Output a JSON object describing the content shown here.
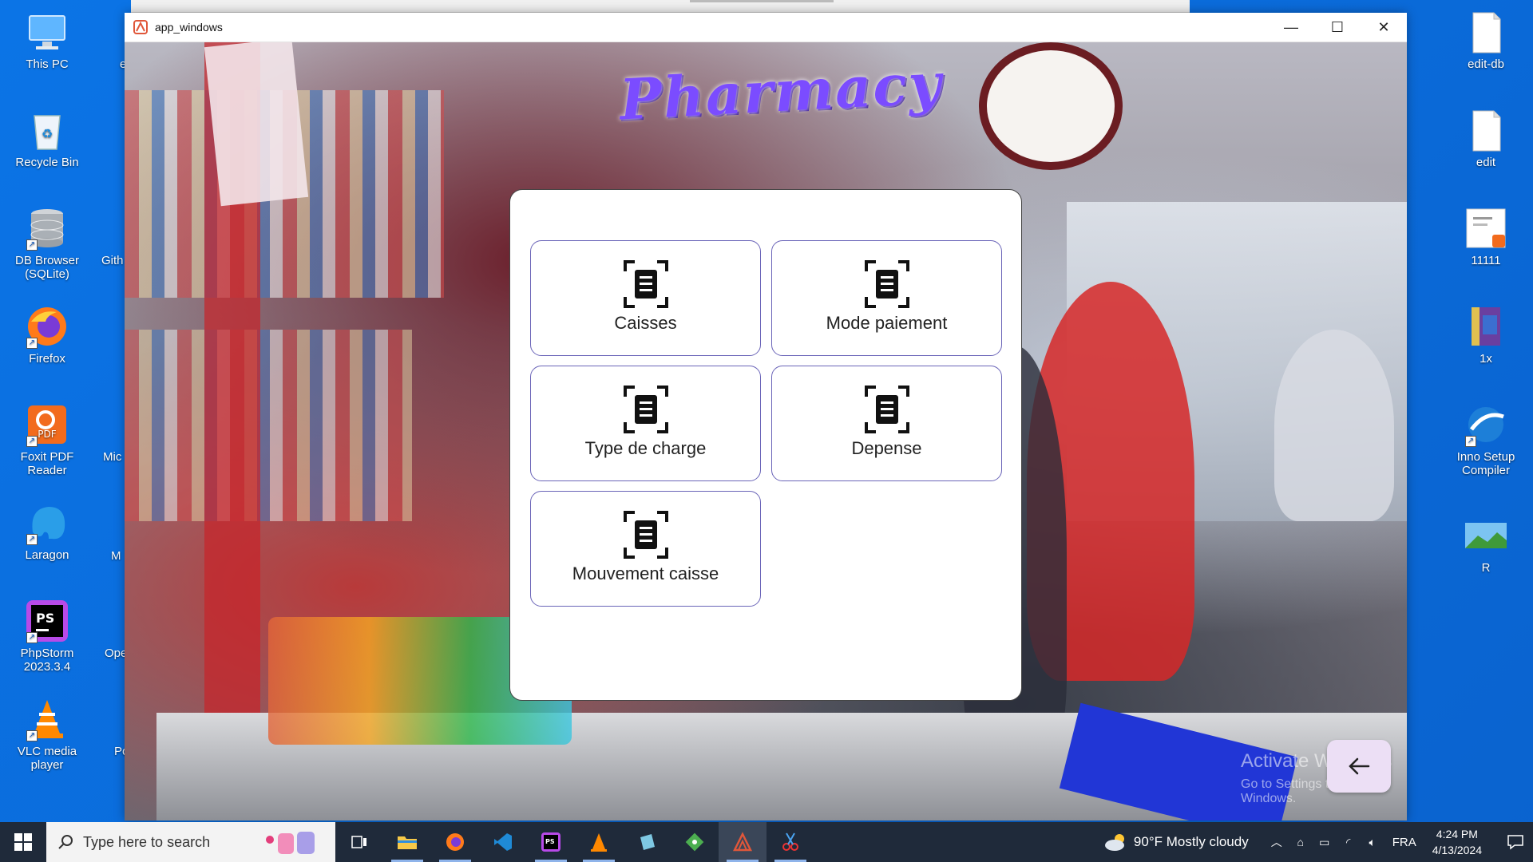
{
  "window": {
    "title": "app_windows",
    "minimize": "—",
    "maximize": "☐",
    "close": "✕"
  },
  "sign_text": "Pharmacy",
  "menu": {
    "items": [
      {
        "label": "Caisses",
        "icon": "receipt-scan-icon"
      },
      {
        "label": "Mode paiement",
        "icon": "receipt-scan-icon"
      },
      {
        "label": "Type de charge",
        "icon": "receipt-scan-icon"
      },
      {
        "label": "Depense",
        "icon": "receipt-scan-icon"
      },
      {
        "label": "Mouvement caisse",
        "icon": "receipt-scan-icon"
      }
    ],
    "back_icon": "arrow-left-icon"
  },
  "activation": {
    "title": "Activate Windows",
    "subtitle": "Go to Settings to activate Windows."
  },
  "desktop": {
    "left_icons": [
      {
        "label": "This PC",
        "icon": "computer-icon"
      },
      {
        "label": "Recycle Bin",
        "icon": "recycle-bin-icon"
      },
      {
        "label": "DB Browser (SQLite)",
        "icon": "database-icon"
      },
      {
        "label": "Firefox",
        "icon": "firefox-icon"
      },
      {
        "label": "Foxit PDF Reader",
        "icon": "pdf-icon"
      },
      {
        "label": "Laragon",
        "icon": "elephant-icon"
      },
      {
        "label": "PhpStorm 2023.3.4",
        "icon": "phpstorm-icon"
      },
      {
        "label": "VLC media player",
        "icon": "vlc-icon"
      }
    ],
    "partial_labels": [
      "e",
      "Gith",
      "Mic",
      "M",
      "Ope",
      "Po"
    ],
    "right_icons": [
      {
        "label": "edit-db",
        "icon": "file-icon"
      },
      {
        "label": "edit",
        "icon": "file-icon"
      },
      {
        "label": "11111",
        "icon": "pdf-file-icon"
      },
      {
        "label": "1x",
        "icon": "winrar-icon"
      },
      {
        "label": "Inno Setup Compiler",
        "icon": "inno-setup-icon"
      },
      {
        "label": "R",
        "icon": "image-icon"
      }
    ]
  },
  "taskbar": {
    "search_placeholder": "Type here to search",
    "apps": [
      "task-view-icon",
      "file-explorer-icon",
      "firefox-icon",
      "vscode-icon",
      "phpstorm-icon",
      "vlc-icon",
      "notepad-icon",
      "git-icon",
      "app-windows-icon",
      "snipping-icon"
    ],
    "weather": "90°F  Mostly cloudy",
    "language": "FRA",
    "time": "4:24 PM",
    "date": "4/13/2024"
  },
  "colors": {
    "desktop_bg": "#0b74e6",
    "card_border": "#6a64b8",
    "fab_bg": "#ecdff5",
    "taskbar_bg": "#1f2a3a"
  }
}
